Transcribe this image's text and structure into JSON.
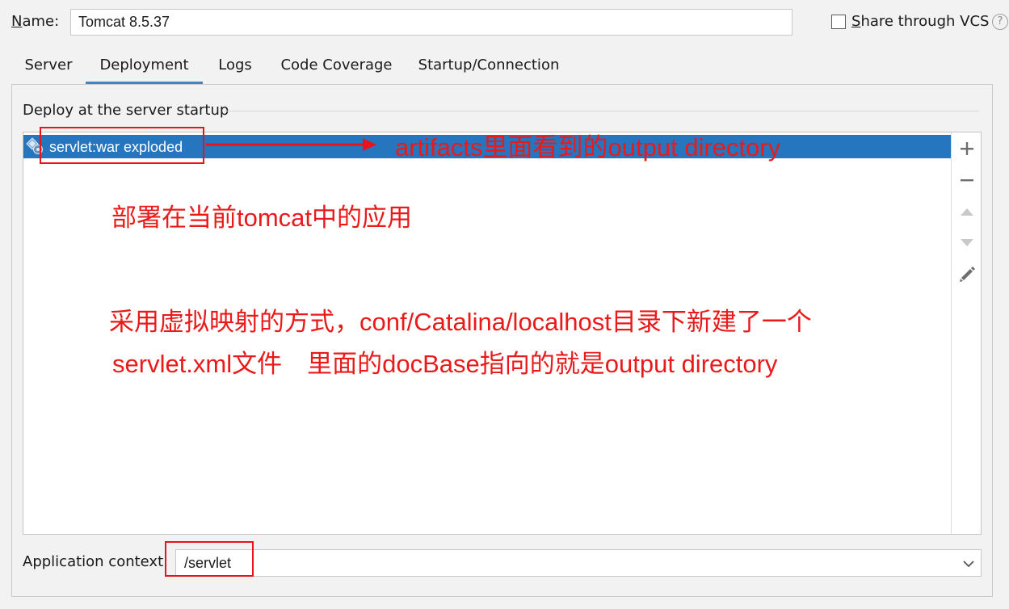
{
  "name": {
    "label_mnemonic": "N",
    "label_rest": "ame:",
    "value": "Tomcat 8.5.37"
  },
  "share": {
    "checked": false,
    "label_mnemonic": "S",
    "label_rest": "hare through VCS",
    "help_glyph": "?"
  },
  "tabs": [
    {
      "label": "Server",
      "active": false
    },
    {
      "label": "Deployment",
      "active": true
    },
    {
      "label": "Logs",
      "active": false
    },
    {
      "label": "Code Coverage",
      "active": false
    },
    {
      "label": "Startup/Connection",
      "active": false
    }
  ],
  "deployment": {
    "section_title": "Deploy at the server startup",
    "items": [
      {
        "label": "servlet:war exploded",
        "selected": true,
        "icon": "artifact-icon"
      }
    ],
    "toolbar": {
      "add": "+",
      "remove": "−",
      "move_up": "up-triangle-icon",
      "move_down": "down-triangle-icon",
      "edit": "pencil-icon"
    }
  },
  "application_context": {
    "label": "Application context:",
    "value": "/servlet"
  },
  "annotations": {
    "artifacts_note": "artifacts里面看到的output directory",
    "deploy_note": "部署在当前tomcat中的应用",
    "virtual_note_1": "采用虚拟映射的方式，conf/Catalina/localhost目录下新建了一个",
    "virtual_note_2": "servlet.xml文件　里面的docBase指向的就是output directory",
    "color": "#e8141c"
  },
  "colors": {
    "accent": "#2675bf",
    "tab_underline": "#4083c9",
    "background": "#f2f2f2"
  }
}
